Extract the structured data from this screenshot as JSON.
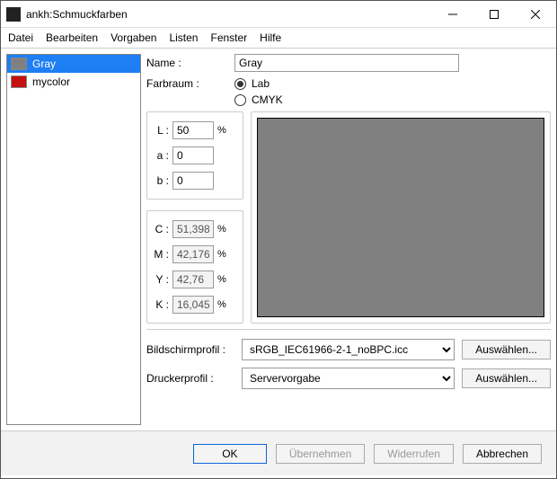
{
  "window": {
    "title": "ankh:Schmuckfarben"
  },
  "menu": {
    "items": [
      "Datei",
      "Bearbeiten",
      "Vorgaben",
      "Listen",
      "Fenster",
      "Hilfe"
    ]
  },
  "sidebar": {
    "items": [
      {
        "name": "Gray",
        "swatch": "#808080",
        "selected": true
      },
      {
        "name": "mycolor",
        "swatch": "#c41010",
        "selected": false
      }
    ]
  },
  "form": {
    "name_label": "Name :",
    "name_value": "Gray",
    "colorspace_label": "Farbraum :",
    "colorspace_options": {
      "lab": "Lab",
      "cmyk": "CMYK"
    },
    "colorspace_selected": "lab"
  },
  "lab": {
    "L_label": "L :",
    "L": "50",
    "a_label": "a :",
    "a": "0",
    "b_label": "b :",
    "b": "0"
  },
  "cmyk": {
    "C_label": "C :",
    "C": "51,398",
    "M_label": "M :",
    "M": "42,176",
    "Y_label": "Y :",
    "Y": "42,76",
    "K_label": "K :",
    "K": "16,045"
  },
  "preview_color": "#808080",
  "profiles": {
    "screen_label": "Bildschirmprofil :",
    "screen_value": "sRGB_IEC61966-2-1_noBPC.icc",
    "printer_label": "Druckerprofil :",
    "printer_value": "Servervorgabe",
    "choose_label": "Auswählen..."
  },
  "footer": {
    "ok": "OK",
    "apply": "Übernehmen",
    "revert": "Widerrufen",
    "cancel": "Abbrechen"
  },
  "percent": "%"
}
